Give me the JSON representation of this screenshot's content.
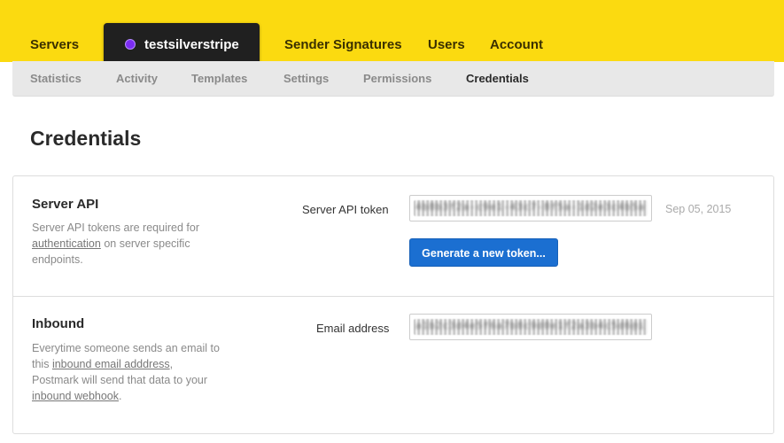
{
  "topnav": {
    "servers": "Servers",
    "server_name": "testsilverstripe",
    "sender_signatures": "Sender Signatures",
    "users": "Users",
    "account": "Account"
  },
  "subnav": {
    "items": [
      "Statistics",
      "Activity",
      "Templates",
      "Settings",
      "Permissions",
      "Credentials"
    ],
    "active": "Credentials"
  },
  "page": {
    "title": "Credentials"
  },
  "server_api": {
    "title": "Server API",
    "desc_pre": "Server API tokens are required for ",
    "desc_link": "authentication",
    "desc_post": " on server specific endpoints.",
    "field_label": "Server API token",
    "token_value": "4b8b3f2a-c9e1-43c7-8f5a-1d2e3c4b5a6f",
    "date": "Sep 05, 2015",
    "generate_button": "Generate a new token..."
  },
  "inbound": {
    "title": "Inbound",
    "desc_pre": "Everytime someone sends an email to this ",
    "desc_link1": "inbound email adddress",
    "desc_mid": ", Postmark will send that data to your ",
    "desc_link2": "inbound webhook",
    "desc_post": ".",
    "field_label": "Email address",
    "email_value": "a1b2c3d4e5f6a7b8c9d0e1f2a3b4c5d6@inbound.postmarkapp.com"
  },
  "colors": {
    "topbar": "#fbda10",
    "server_tab": "#202020",
    "server_dot": "#7b2cf2",
    "primary_button": "#1b6fd1"
  }
}
